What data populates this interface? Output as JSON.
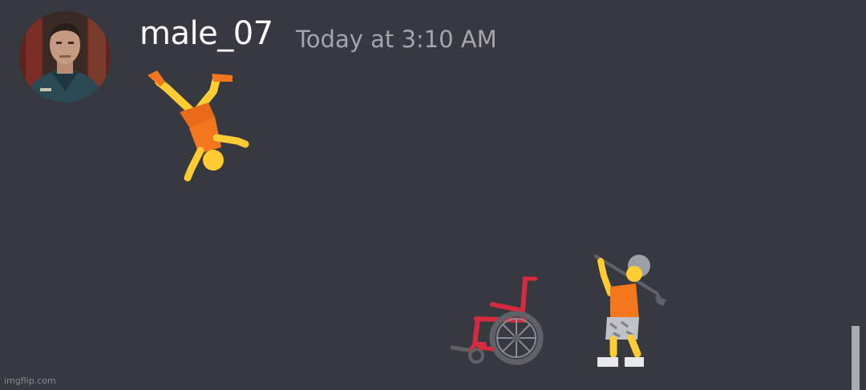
{
  "message": {
    "author": "male_07",
    "timestamp": "Today at 3:10 AM",
    "emojis": [
      "person-cartwheeling",
      "manual-wheelchair",
      "person-golfing"
    ]
  },
  "watermark": "imgflip.com",
  "colors": {
    "background": "#36393f",
    "username": "#ffffff",
    "timestamp": "#a3a6aa",
    "emoji_body": "#ffcc33",
    "emoji_shirt": "#f4771d",
    "wheelchair_frame": "#d62b3f"
  }
}
